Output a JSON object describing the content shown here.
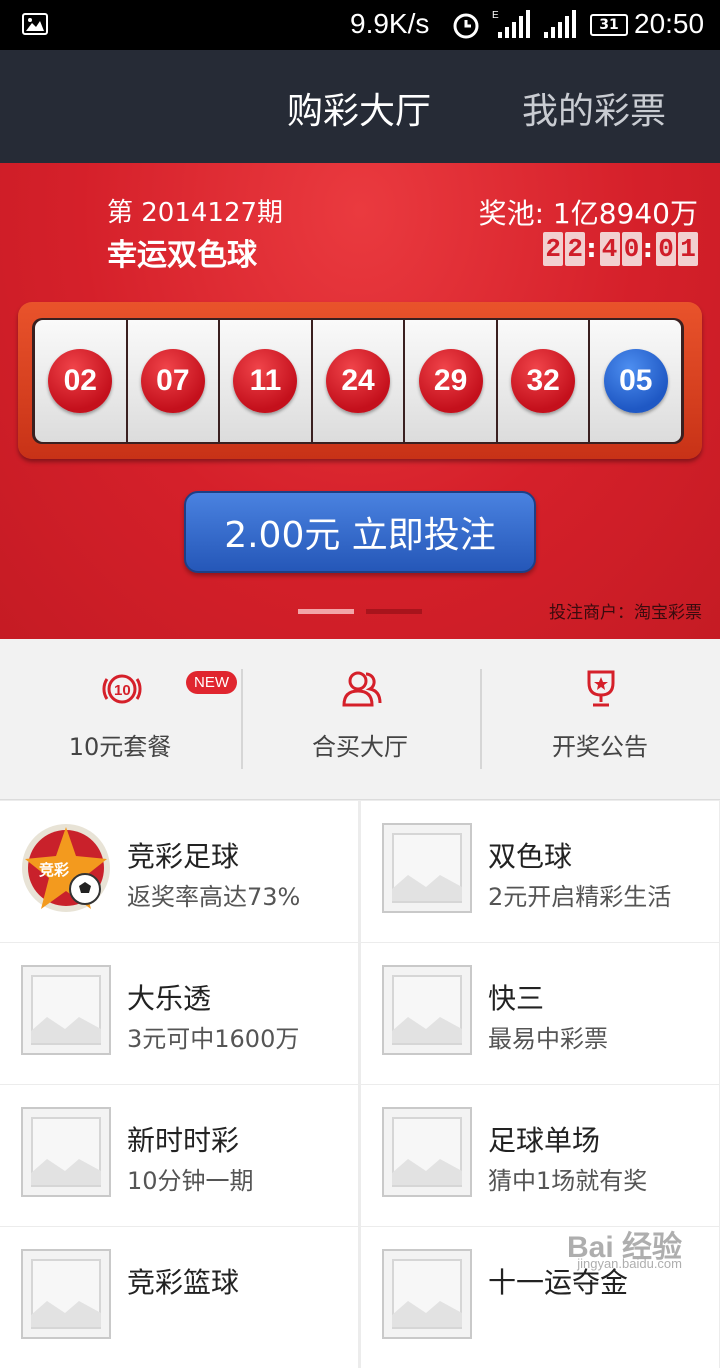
{
  "status_bar": {
    "speed": "9.9K/s",
    "battery": "31",
    "time": "20:50"
  },
  "header": {
    "tabs": [
      {
        "label": "购彩大厅",
        "active": true
      },
      {
        "label": "我的彩票",
        "active": false
      }
    ]
  },
  "hero": {
    "issue": "第 2014127期",
    "game": "幸运双色球",
    "pool": "奖池: 1亿8940万",
    "countdown": [
      "2",
      "2",
      ":",
      "4",
      "0",
      ":",
      "0",
      "1"
    ],
    "balls": [
      {
        "num": "02",
        "color": "red"
      },
      {
        "num": "07",
        "color": "red"
      },
      {
        "num": "11",
        "color": "red"
      },
      {
        "num": "24",
        "color": "red"
      },
      {
        "num": "29",
        "color": "red"
      },
      {
        "num": "32",
        "color": "red"
      },
      {
        "num": "05",
        "color": "blue"
      }
    ],
    "bet_button": "2.00元  立即投注",
    "merchant": "投注商户：淘宝彩票",
    "pager_active_index": 0
  },
  "quick_menu": [
    {
      "label": "10元套餐",
      "icon": "ten-yuan-icon",
      "badge": "NEW"
    },
    {
      "label": "合买大厅",
      "icon": "group-icon"
    },
    {
      "label": "开奖公告",
      "icon": "trophy-icon"
    }
  ],
  "lotteries": [
    {
      "title": "竞彩足球",
      "subtitle": "返奖率高达73%",
      "logo": "jingcai-football-logo"
    },
    {
      "title": "双色球",
      "subtitle": "2元开启精彩生活",
      "logo": "image-placeholder-icon"
    },
    {
      "title": "大乐透",
      "subtitle": "3元可中1600万",
      "logo": "image-placeholder-icon"
    },
    {
      "title": "快三",
      "subtitle": "最易中彩票",
      "logo": "image-placeholder-icon"
    },
    {
      "title": "新时时彩",
      "subtitle": "10分钟一期",
      "logo": "image-placeholder-icon"
    },
    {
      "title": "足球单场",
      "subtitle": "猜中1场就有奖",
      "logo": "image-placeholder-icon"
    },
    {
      "title": "竞彩篮球",
      "subtitle": "",
      "logo": "image-placeholder-icon"
    },
    {
      "title": "十一运夺金",
      "subtitle": "",
      "logo": "image-placeholder-icon"
    }
  ],
  "watermark": {
    "brand": "Bai 经验",
    "url": "jingyan.baidu.com"
  },
  "colors": {
    "header_bg": "#262b36",
    "hero_red": "#d5202a",
    "button_blue": "#2f65c9",
    "accent_red": "#d5202a"
  }
}
